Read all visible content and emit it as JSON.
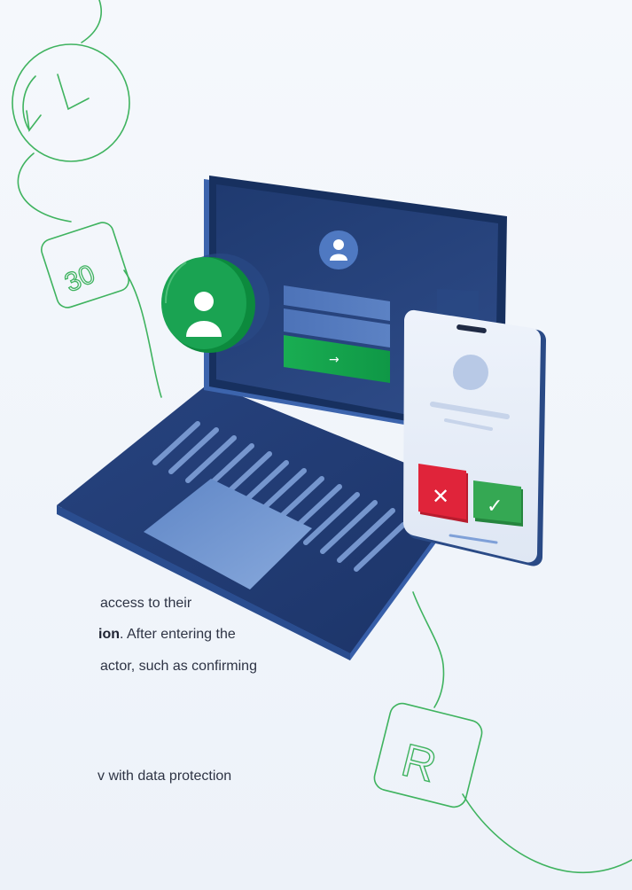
{
  "text_fragments": {
    "line1": "access to their",
    "line2_bold": "ion",
    "line2_rest": ". After entering the",
    "line3": "actor, such as confirming",
    "line4": "v with data protection"
  },
  "illustration": {
    "calendar_day": "30",
    "tile_letter": "R",
    "login_button_glyph": "→",
    "reject_glyph": "✕",
    "approve_glyph": "✓"
  },
  "colors": {
    "line_art": "#3fb35f",
    "laptop_body": "#2e4d8f",
    "screen": "#2b4478",
    "green_accent": "#10a24a",
    "reject": "#e0243a",
    "approve": "#35a853"
  }
}
